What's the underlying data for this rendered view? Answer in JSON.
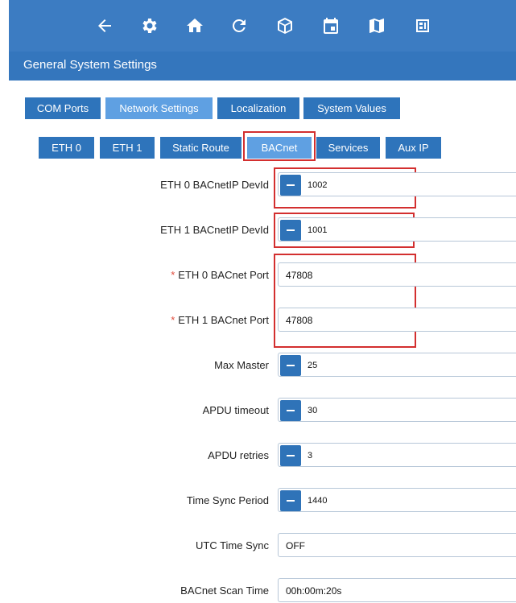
{
  "toolbar": {
    "icons": [
      "back-arrow-icon",
      "gear-icon",
      "home-icon",
      "refresh-icon",
      "cube-icon",
      "calendar-icon",
      "map-icon",
      "dashboard-icon"
    ]
  },
  "header": {
    "title": "General System Settings"
  },
  "tabs": [
    {
      "label": "COM Ports"
    },
    {
      "label": "Network Settings",
      "active": true
    },
    {
      "label": "Localization"
    },
    {
      "label": "System Values"
    }
  ],
  "subtabs": [
    {
      "label": "ETH 0"
    },
    {
      "label": "ETH 1"
    },
    {
      "label": "Static Route"
    },
    {
      "label": "BACnet",
      "active": true
    },
    {
      "label": "Services"
    },
    {
      "label": "Aux IP"
    }
  ],
  "fields": [
    {
      "label": "ETH 0 BACnetIP DevId",
      "value": "1002",
      "type": "stepper"
    },
    {
      "label": "ETH 1 BACnetIP DevId",
      "value": "1001",
      "type": "stepper"
    },
    {
      "label": "ETH 0 BACnet Port",
      "value": "47808",
      "type": "text",
      "required": true
    },
    {
      "label": "ETH 1 BACnet Port",
      "value": "47808",
      "type": "text",
      "required": true
    },
    {
      "label": "Max Master",
      "value": "25",
      "type": "stepper"
    },
    {
      "label": "APDU timeout",
      "value": "30",
      "type": "stepper"
    },
    {
      "label": "APDU retries",
      "value": "3",
      "type": "stepper"
    },
    {
      "label": "Time Sync Period",
      "value": "1440",
      "type": "stepper"
    },
    {
      "label": "UTC Time Sync",
      "value": "OFF",
      "type": "select"
    },
    {
      "label": "BACnet Scan Time",
      "value": "00h:00m:20s",
      "type": "text"
    }
  ],
  "colors": {
    "toolbar": "#3c7cc2",
    "titlebar": "#3476bd",
    "tab": "#2e74bb",
    "tab_active": "#5fa0e2",
    "highlight": "#d32f2f",
    "required": "#e04b3c"
  }
}
